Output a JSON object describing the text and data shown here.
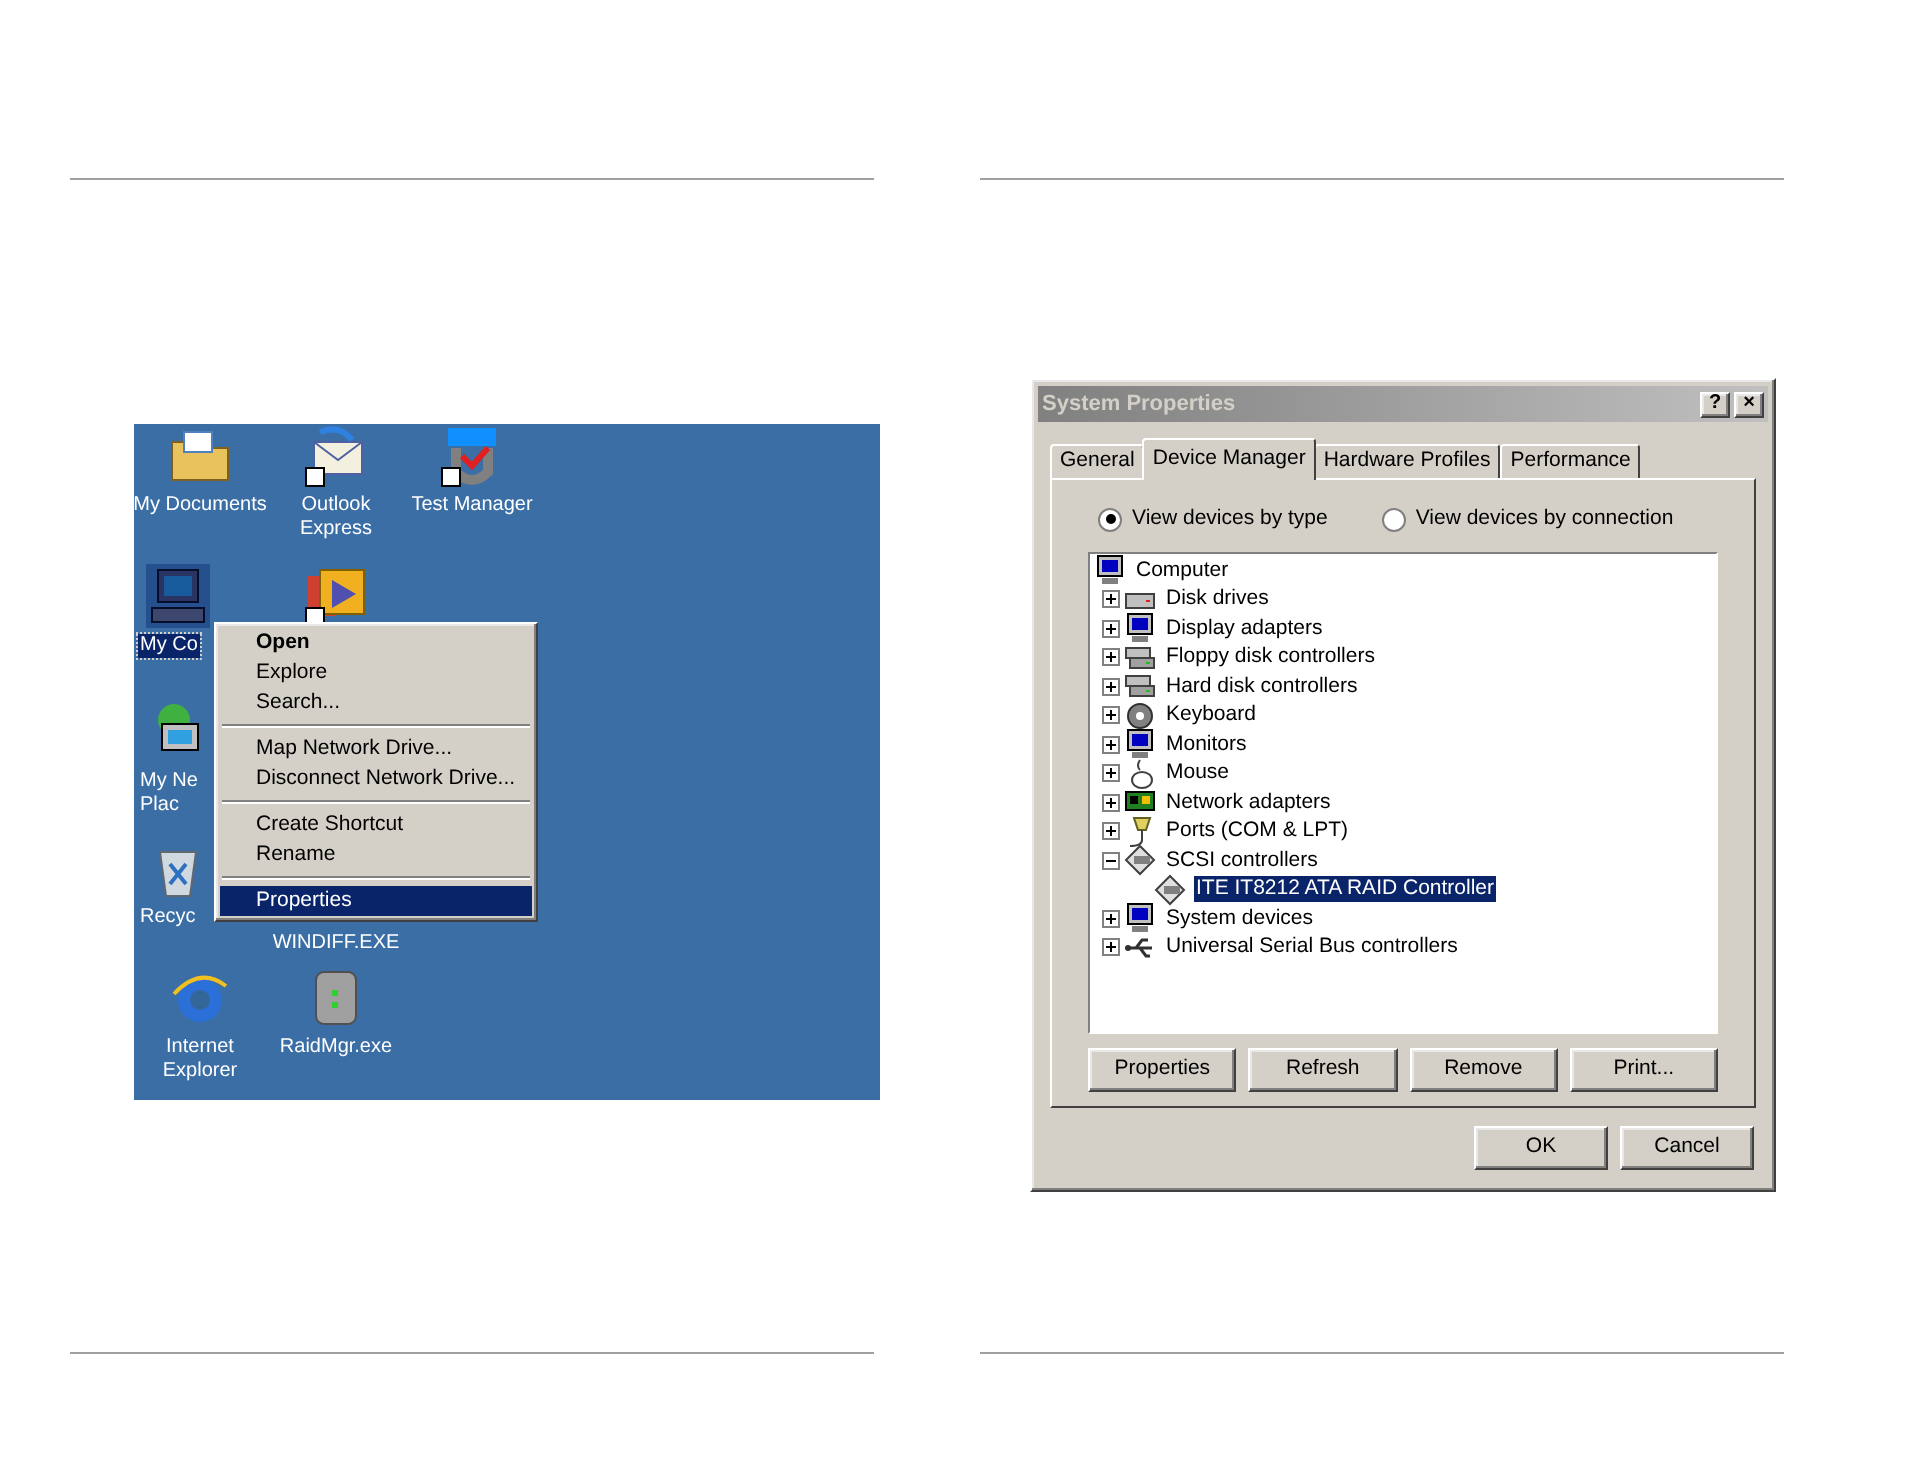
{
  "desktop": {
    "icons": [
      {
        "kind": "folder",
        "lines": [
          "My Documents"
        ],
        "selected": false
      },
      {
        "kind": "mail",
        "lines": [
          "Outlook",
          "Express"
        ],
        "selected": false
      },
      {
        "kind": "app",
        "lines": [
          "Test Manager"
        ],
        "selected": false
      },
      {
        "kind": "computer",
        "lines": [
          "My Co"
        ],
        "selected": true
      },
      {
        "kind": "media",
        "selected": false
      },
      {
        "kind": "network",
        "lines": [
          "My Ne",
          "Plac"
        ],
        "selected": false
      },
      {
        "kind": "recycle",
        "lines": [
          "Recyc"
        ],
        "selected": false
      },
      {
        "lines": [
          "WINDIFF.EXE"
        ],
        "selected": false
      },
      {
        "kind": "browser",
        "lines": [
          "Internet",
          "Explorer"
        ],
        "selected": false
      },
      {
        "kind": "disk",
        "lines": [
          "RaidMgr.exe"
        ],
        "selected": false
      }
    ]
  },
  "context_menu": {
    "items": [
      {
        "kind": "item",
        "label": "Open",
        "default": true,
        "selected": false
      },
      {
        "kind": "item",
        "label": "Explore",
        "default": false,
        "selected": false
      },
      {
        "kind": "item",
        "label": "Search...",
        "default": false,
        "selected": false
      },
      {
        "kind": "separator"
      },
      {
        "kind": "item",
        "label": "Map Network Drive...",
        "default": false,
        "selected": false
      },
      {
        "kind": "item",
        "label": "Disconnect Network Drive...",
        "default": false,
        "selected": false
      },
      {
        "kind": "separator"
      },
      {
        "kind": "item",
        "label": "Create Shortcut",
        "default": false,
        "selected": false
      },
      {
        "kind": "item",
        "label": "Rename",
        "default": false,
        "selected": false
      },
      {
        "kind": "separator"
      },
      {
        "kind": "item",
        "label": "Properties",
        "default": false,
        "selected": true
      }
    ]
  },
  "dialog": {
    "title": "System Properties",
    "title_buttons": [
      "?",
      "×"
    ],
    "tabs": [
      {
        "label": "General",
        "selected": false
      },
      {
        "label": "Device Manager",
        "selected": true
      },
      {
        "label": "Hardware Profiles",
        "selected": false
      },
      {
        "label": "Performance",
        "selected": false
      }
    ],
    "view_options": [
      {
        "label": "View devices by type",
        "selected": true
      },
      {
        "label": "View devices by connection",
        "selected": false
      }
    ],
    "tree": {
      "label": "Computer",
      "kind": "computer",
      "selected": false,
      "children": [
        {
          "label": "Disk drives",
          "kind": "drive",
          "selected": false,
          "expanded": false
        },
        {
          "label": "Display adapters",
          "kind": "monitor",
          "selected": false,
          "expanded": false
        },
        {
          "label": "Floppy disk controllers",
          "kind": "controller",
          "selected": false,
          "expanded": false
        },
        {
          "label": "Hard disk controllers",
          "kind": "controller",
          "selected": false,
          "expanded": false
        },
        {
          "label": "Keyboard",
          "kind": "keyboard",
          "selected": false,
          "expanded": false
        },
        {
          "label": "Monitors",
          "kind": "monitor",
          "selected": false,
          "expanded": false
        },
        {
          "label": "Mouse",
          "kind": "mouse",
          "selected": false,
          "expanded": false
        },
        {
          "label": "Network adapters",
          "kind": "card",
          "selected": false,
          "expanded": false
        },
        {
          "label": "Ports (COM & LPT)",
          "kind": "port",
          "selected": false,
          "expanded": false
        },
        {
          "label": "SCSI controllers",
          "kind": "scsi",
          "selected": false,
          "expanded": true,
          "children": [
            {
              "label": "ITE IT8212 ATA RAID Controller",
              "kind": "scsi",
              "selected": true
            }
          ]
        },
        {
          "label": "System devices",
          "kind": "monitor",
          "selected": false,
          "expanded": false
        },
        {
          "label": "Universal Serial Bus controllers",
          "kind": "usb",
          "selected": false,
          "expanded": false
        }
      ]
    },
    "device_buttons": [
      {
        "label": "Properties"
      },
      {
        "label": "Refresh"
      },
      {
        "label": "Remove"
      },
      {
        "label": "Print..."
      }
    ],
    "footer_buttons": [
      {
        "label": "OK"
      },
      {
        "label": "Cancel"
      }
    ]
  }
}
